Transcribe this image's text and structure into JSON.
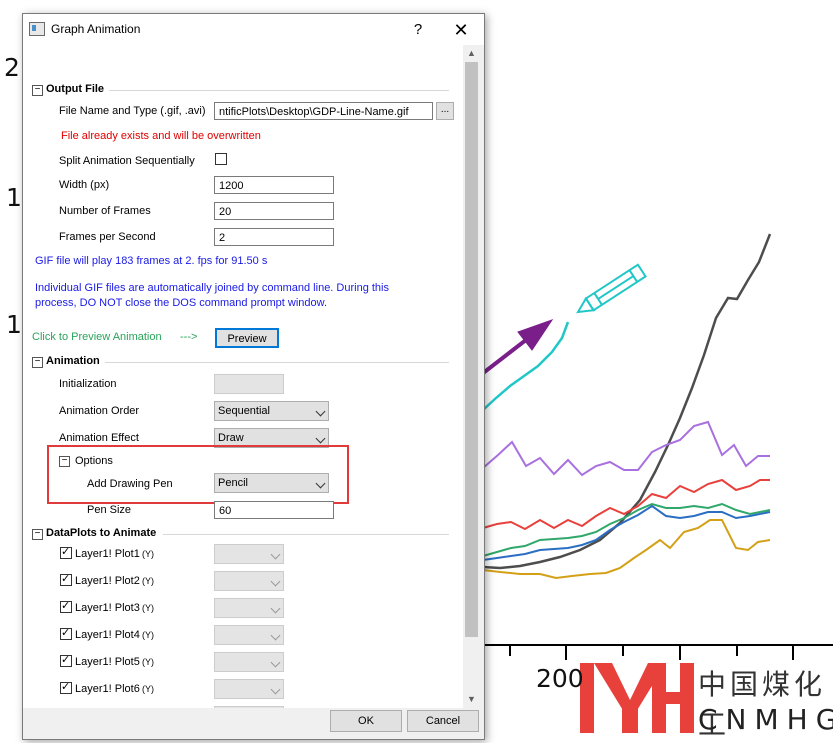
{
  "background": {
    "axis_tick_labels": [
      "1",
      "1",
      "1",
      "2",
      "200"
    ],
    "series_colors": [
      "#4d4d4d",
      "#a970e0",
      "#e8413c",
      "#2fa86a",
      "#2a6ec4",
      "#d4a017",
      "#21c7c7"
    ],
    "arrow_color": "#7a1f8a",
    "logo_cn": "中国煤化工",
    "logo_en": "CNMHG"
  },
  "dialog": {
    "title": "Graph Animation",
    "help_label": "?",
    "close_label": "✕",
    "sections": {
      "output_file": {
        "toggle": "−",
        "title": "Output File",
        "file_label": "File Name and Type (.gif, .avi)",
        "file_value": "ntificPlots\\Desktop\\GDP-Line-Name.gif",
        "browse_label": "...",
        "warning": "File already exists and will be overwritten",
        "split_label": "Split Animation Sequentially",
        "split_checked": false,
        "width_label": "Width (px)",
        "width_value": "1200",
        "frames_label": "Number of Frames",
        "frames_value": "20",
        "fps_label": "Frames per Second",
        "fps_value": "2",
        "info1": "GIF file will play 183 frames at 2. fps for 91.50 s",
        "info2_line1": "Individual GIF files are automatically joined by command line. During this",
        "info2_line2": "process, DO NOT close the DOS command prompt window.",
        "preview_hint": "Click to Preview Animation",
        "preview_arrow": "--->",
        "preview_button": "Preview"
      },
      "animation": {
        "toggle": "−",
        "title": "Animation",
        "init_label": "Initialization",
        "init_value": "",
        "order_label": "Animation Order",
        "order_value": "Sequential",
        "effect_label": "Animation Effect",
        "effect_value": "Draw",
        "options_toggle": "−",
        "options_title": "Options",
        "pen_label": "Add Drawing Pen",
        "pen_value": "Pencil",
        "pensize_label": "Pen Size",
        "pensize_value": "60"
      },
      "dataplots": {
        "toggle": "−",
        "title": "DataPlots to Animate",
        "plots": [
          {
            "label": "Layer1! Plot1",
            "suffix": "(Y)",
            "checked": true
          },
          {
            "label": "Layer1! Plot2",
            "suffix": "(Y)",
            "checked": true
          },
          {
            "label": "Layer1! Plot3",
            "suffix": "(Y)",
            "checked": true
          },
          {
            "label": "Layer1! Plot4",
            "suffix": "(Y)",
            "checked": true
          },
          {
            "label": "Layer1! Plot5",
            "suffix": "(Y)",
            "checked": true
          },
          {
            "label": "Layer1! Plot6",
            "suffix": "(Y)",
            "checked": true
          }
        ]
      }
    },
    "ok_label": "OK",
    "cancel_label": "Cancel"
  }
}
